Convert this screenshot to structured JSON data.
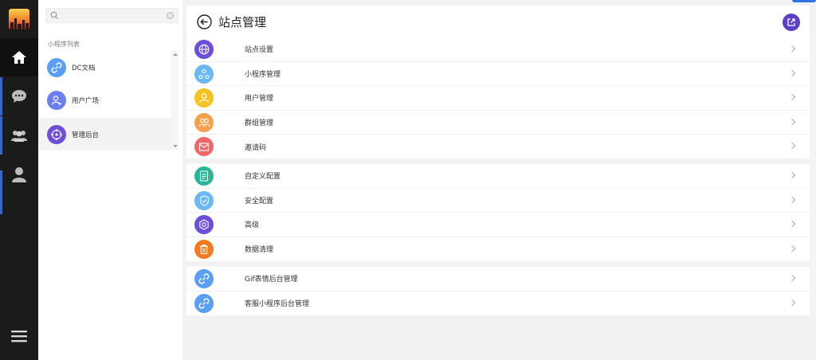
{
  "sidebar": {
    "nav": [
      {
        "name": "home",
        "icon": "home-icon"
      },
      {
        "name": "chat",
        "icon": "chat-icon"
      },
      {
        "name": "groups",
        "icon": "users-icon"
      },
      {
        "name": "profile",
        "icon": "user-icon"
      }
    ],
    "menu_icon": "menu-icon",
    "accent": "#3d6fd8"
  },
  "panel": {
    "search": {
      "value": "",
      "placeholder": ""
    },
    "list_title": "小程序列表",
    "items": [
      {
        "label": "DC文档",
        "icon": "link-icon",
        "color": "#5b9ef5"
      },
      {
        "label": "用户广场",
        "icon": "user-square-icon",
        "color": "#6a7ff0"
      },
      {
        "label": "管理后台",
        "icon": "admin-network-icon",
        "color": "#6b4fd8"
      }
    ]
  },
  "main": {
    "title": "站点管理",
    "groups": [
      [
        {
          "label": "站点设置",
          "icon": "globe-icon",
          "color": "#6b4fd8"
        },
        {
          "label": "小程序管理",
          "icon": "apps-icon",
          "color": "#6cb8f5"
        },
        {
          "label": "用户管理",
          "icon": "user-icon",
          "color": "#f7c120"
        },
        {
          "label": "群组管理",
          "icon": "group-icon",
          "color": "#f6a04d"
        },
        {
          "label": "邀请码",
          "icon": "mail-icon",
          "color": "#f0676a"
        }
      ],
      [
        {
          "label": "自定义配置",
          "icon": "doc-icon",
          "color": "#2ab59a"
        },
        {
          "label": "安全配置",
          "icon": "shield-icon",
          "color": "#6cb8f5"
        },
        {
          "label": "高级",
          "icon": "gear-icon",
          "color": "#6b4fd8"
        },
        {
          "label": "数据清理",
          "icon": "trash-icon",
          "color": "#f47a1f"
        }
      ],
      [
        {
          "label": "Gif表情后台管理",
          "icon": "link-icon",
          "color": "#5b9ef5"
        },
        {
          "label": "客服小程序后台管理",
          "icon": "link-icon",
          "color": "#5b9ef5"
        }
      ]
    ]
  }
}
